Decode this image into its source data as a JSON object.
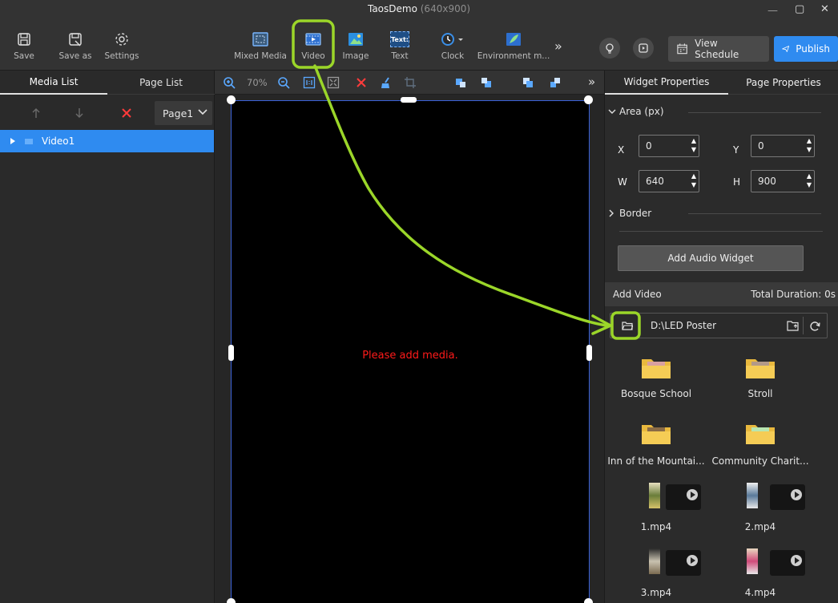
{
  "window": {
    "title": "TaosDemo",
    "resolution": "(640x900)",
    "minimize": "—",
    "maximize": "▢",
    "close": "✕"
  },
  "toolbar": {
    "save": "Save",
    "save_as": "Save as",
    "settings": "Settings",
    "mixed_media": "Mixed Media",
    "video": "Video",
    "image": "Image",
    "text": "Text",
    "text_icon": "Text:",
    "clock": "Clock",
    "environment": "Environment m...",
    "more": "»",
    "view_schedule": "View Schedule",
    "publish": "Publish"
  },
  "left_panel": {
    "tabs": {
      "media_list": "Media List",
      "page_list": "Page List"
    },
    "page_selector": "Page1",
    "items": [
      {
        "label": "Video1"
      }
    ]
  },
  "canvas": {
    "zoom": "70%",
    "placeholder": "Please add media.",
    "more": "»"
  },
  "right_panel": {
    "tabs": {
      "widget_properties": "Widget Properties",
      "page_properties": "Page Properties"
    },
    "area": {
      "title": "Area (px)",
      "x_label": "X",
      "x_value": "0",
      "y_label": "Y",
      "y_value": "0",
      "w_label": "W",
      "w_value": "640",
      "h_label": "H",
      "h_value": "900"
    },
    "border": {
      "title": "Border"
    },
    "add_audio_button": "Add Audio Widget",
    "add_video": {
      "title": "Add Video",
      "total_duration": "Total Duration: 0s",
      "path": "D:\\LED Poster"
    },
    "folders": [
      {
        "name": "Bosque School"
      },
      {
        "name": "Stroll"
      },
      {
        "name": "Inn of the Mountai..."
      },
      {
        "name": "Community Charit..."
      }
    ],
    "videos": [
      {
        "name": "1.mp4"
      },
      {
        "name": "2.mp4"
      },
      {
        "name": "3.mp4"
      },
      {
        "name": "4.mp4"
      }
    ]
  },
  "colors": {
    "accent": "#2f8bf0",
    "annotation": "#9bd629",
    "placeholder_text": "#ff1a1a"
  }
}
